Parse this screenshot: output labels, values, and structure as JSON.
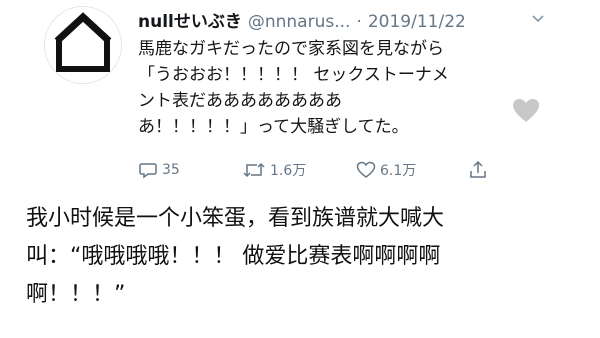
{
  "tweet": {
    "display_name": "nullせいぶき",
    "handle": "@nnnarus...",
    "separator": "·",
    "date": "2019/11/22",
    "text": "馬鹿なガキだったので家系図を見ながら\n「うおおお！！！！！ セックストーナメ\nント表だああああああああ\nあ！！！！！」って大騒ぎしてた。",
    "actions": {
      "reply_count": "35",
      "retweet_count": "1.6万",
      "like_count": "6.1万"
    }
  },
  "caption": {
    "text": "我小时候是一个小笨蛋，看到族谱就大喊大\n叫：“哦哦哦哦！！！ 做爱比赛表啊啊啊啊\n啊！！！”"
  },
  "icons": {
    "avatar": "house-outline-avatar",
    "menu": "chevron-down-icon",
    "reply": "reply-icon",
    "retweet": "retweet-icon",
    "like": "heart-icon",
    "share": "share-icon"
  },
  "colors": {
    "text": "#14171a",
    "secondary": "#657786",
    "floating_heart": "#c8c8c8"
  }
}
